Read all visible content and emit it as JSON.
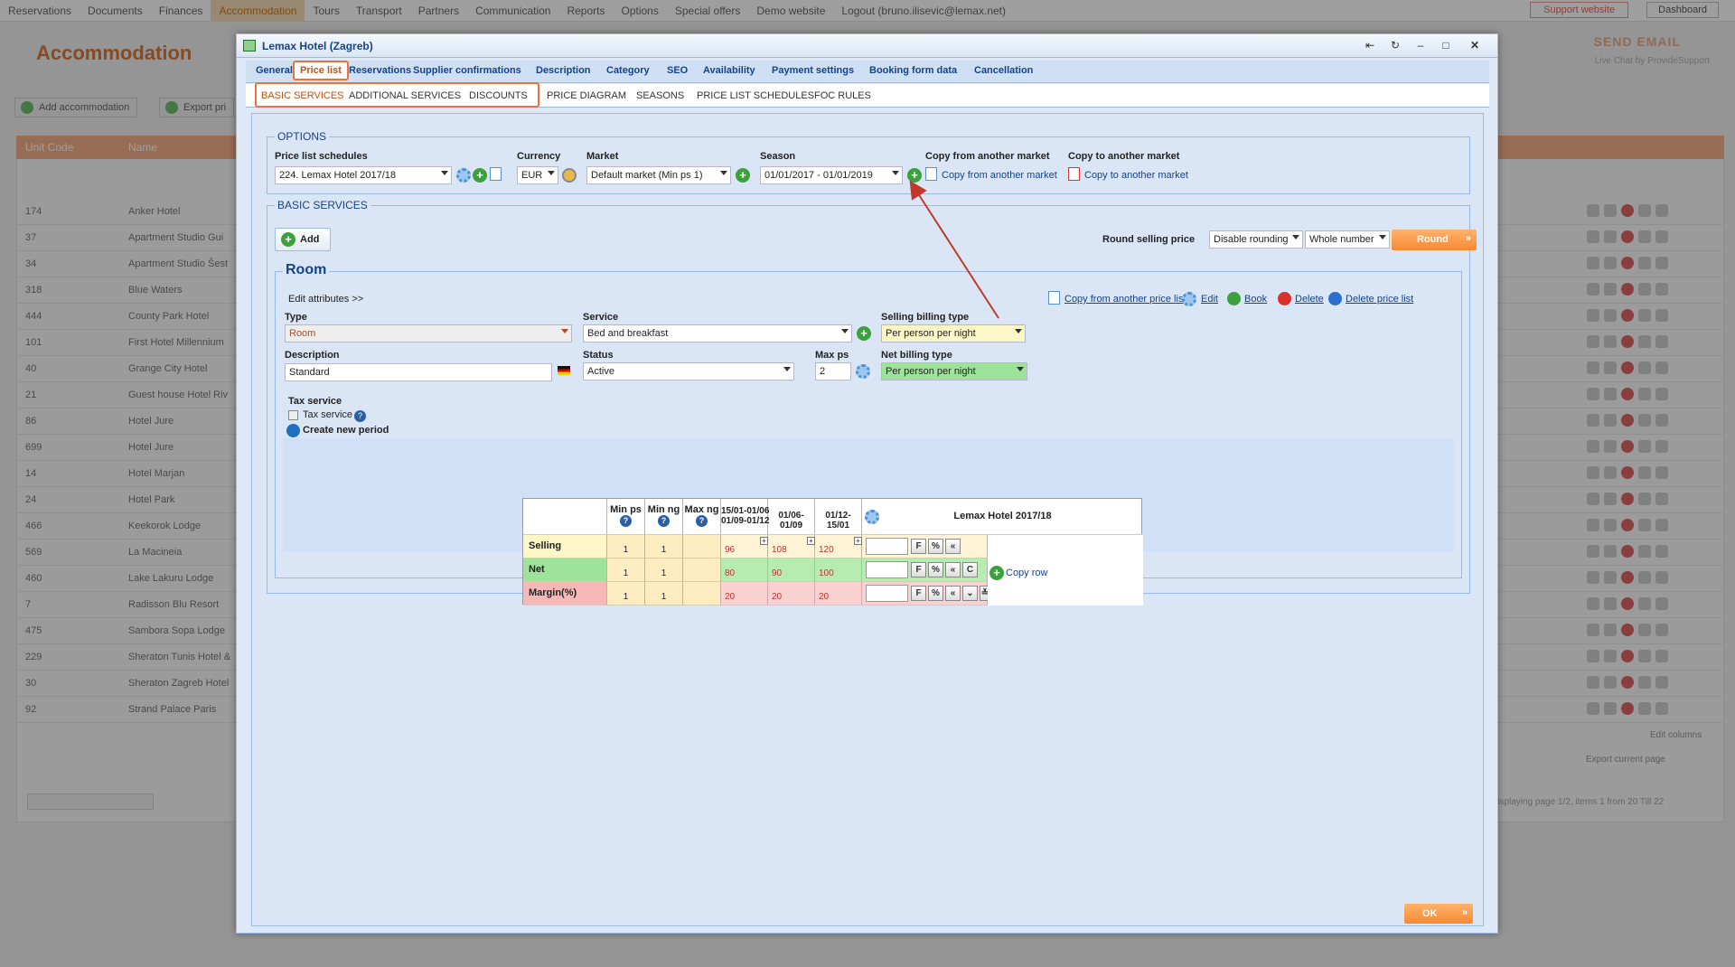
{
  "app": {
    "nav": [
      "Reservations",
      "Documents",
      "Finances",
      "Accommodation",
      "Tours",
      "Transport",
      "Partners",
      "Communication",
      "Reports",
      "Options",
      "Special offers",
      "Demo website",
      "Logout (bruno.ilisevic@lemax.net)"
    ],
    "support_label": "Support website",
    "dashboard_label": "Dashboard",
    "page_title": "Accommodation",
    "send_email": "SEND EMAIL",
    "live_chat": "Live Chat by ProvideSupport",
    "add_accommodation": "Add accommodation",
    "export_prices": "Export pri",
    "col_unit_code": "Unit Code",
    "col_name": "Name",
    "rows": [
      {
        "code": "174",
        "name": "Anker Hotel"
      },
      {
        "code": "37",
        "name": "Apartment Studio Gui"
      },
      {
        "code": "34",
        "name": "Apartment Studio Šest"
      },
      {
        "code": "318",
        "name": "Blue Waters"
      },
      {
        "code": "444",
        "name": "County Park Hotel"
      },
      {
        "code": "101",
        "name": "First Hotel Millennium"
      },
      {
        "code": "40",
        "name": "Grange City Hotel"
      },
      {
        "code": "21",
        "name": "Guest house Hotel Riv"
      },
      {
        "code": "86",
        "name": "Hotel Jure"
      },
      {
        "code": "699",
        "name": "Hotel Jure"
      },
      {
        "code": "14",
        "name": "Hotel Marjan"
      },
      {
        "code": "24",
        "name": "Hotel Park"
      },
      {
        "code": "466",
        "name": "Keekorok Lodge"
      },
      {
        "code": "569",
        "name": "La Macineia"
      },
      {
        "code": "460",
        "name": "Lake Lakuru Lodge"
      },
      {
        "code": "7",
        "name": "Radisson Blu Resort"
      },
      {
        "code": "475",
        "name": "Sambora Sopa Lodge"
      },
      {
        "code": "229",
        "name": "Sheraton Tunis Hotel &"
      },
      {
        "code": "30",
        "name": "Sheraton Zagreb Hotel"
      },
      {
        "code": "92",
        "name": "Strand Palace Paris"
      }
    ],
    "edit_columns": "Edit columns",
    "export_current_page": "Export current page",
    "paging_info": "Displaying page 1/2, items 1 from 20 Till 22"
  },
  "dialog": {
    "title": "Lemax Hotel (Zagreb)",
    "tabs": [
      "General",
      "Price list",
      "Reservations",
      "Supplier confirmations",
      "Description",
      "Category",
      "SEO",
      "Availability",
      "Payment settings",
      "Booking form data",
      "Cancellation"
    ],
    "subtabs": [
      "BASIC SERVICES",
      "ADDITIONAL SERVICES",
      "DISCOUNTS",
      "PRICE DIAGRAM",
      "SEASONS",
      "PRICE LIST SCHEDULES",
      "FOC RULES"
    ],
    "options": {
      "legend": "OPTIONS",
      "schedules_label": "Price list schedules",
      "schedules_value": "224. Lemax Hotel 2017/18",
      "currency_label": "Currency",
      "currency_value": "EUR",
      "market_label": "Market",
      "market_value": "Default market (Min ps 1)",
      "season_label": "Season",
      "season_value": "01/01/2017 - 01/01/2019",
      "copy_from_label": "Copy from another market",
      "copy_from_link": "Copy from another market",
      "copy_to_label": "Copy to another market",
      "copy_to_link": "Copy to another market"
    },
    "basic": {
      "legend": "BASIC SERVICES",
      "add_label": "Add",
      "round_label": "Round selling price",
      "rounding_value": "Disable rounding",
      "number_value": "Whole number",
      "round_button": "Round"
    },
    "room": {
      "legend": "Room",
      "edit_attributes": "Edit attributes >>",
      "copy_price_list": "Copy from another price list",
      "edit": "Edit",
      "book": "Book",
      "delete": "Delete",
      "delete_price_list": "Delete price list",
      "type_label": "Type",
      "type_value": "Room",
      "service_label": "Service",
      "service_value": "Bed and breakfast",
      "selling_billing_label": "Selling billing type",
      "selling_billing_value": "Per person per night",
      "description_label": "Description",
      "description_value": "Standard",
      "status_label": "Status",
      "status_value": "Active",
      "maxps_label": "Max ps",
      "maxps_value": "2",
      "net_billing_label": "Net billing type",
      "net_billing_value": "Per person per night",
      "tax_service_title": "Tax service",
      "tax_service_checkbox": "Tax service",
      "create_period": "Create new period"
    },
    "grid": {
      "headers": [
        "Min ps",
        "Min ng",
        "Max ng",
        "15/01-01/06\n01/09-01/12",
        "01/06-01/09",
        "01/12-15/01",
        "Lemax Hotel 2017/18"
      ],
      "rows": [
        {
          "label": "Selling",
          "min_ps": "1",
          "min_ng": "1",
          "max_ng": "",
          "v1": "96",
          "v2": "108",
          "v3": "120"
        },
        {
          "label": "Net",
          "min_ps": "1",
          "min_ng": "1",
          "max_ng": "",
          "v1": "80",
          "v2": "90",
          "v3": "100"
        },
        {
          "label": "Margin(%)",
          "min_ps": "1",
          "min_ng": "1",
          "max_ng": "",
          "v1": "20",
          "v2": "20",
          "v3": "20"
        }
      ],
      "copy_row": "Copy row"
    },
    "ok_label": "OK"
  }
}
